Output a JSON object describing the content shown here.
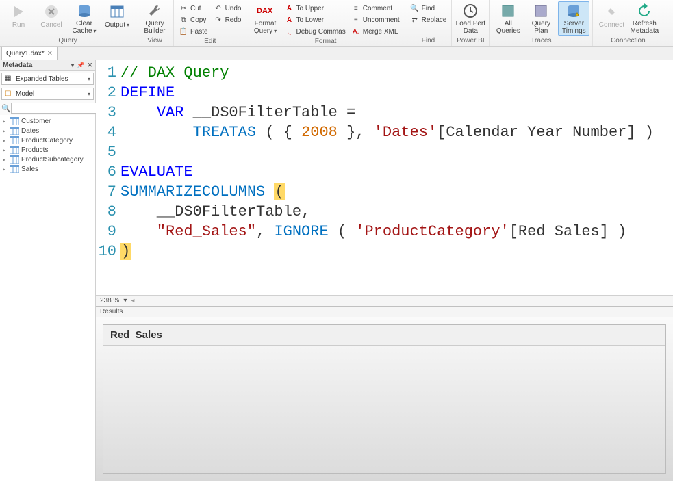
{
  "ribbon": {
    "groups": {
      "query": {
        "label": "Query",
        "run": "Run",
        "cancel": "Cancel",
        "clear_cache": "Clear\nCache",
        "output": "Output"
      },
      "view": {
        "label": "View",
        "query_builder": "Query\nBuilder"
      },
      "edit": {
        "label": "Edit",
        "cut": "Cut",
        "copy": "Copy",
        "paste": "Paste",
        "undo": "Undo",
        "redo": "Redo"
      },
      "format": {
        "label": "Format",
        "dax": "Format\nQuery",
        "to_upper": "To Upper",
        "to_lower": "To Lower",
        "debug_commas": "Debug Commas",
        "comment": "Comment",
        "uncomment": "Uncomment",
        "merge_xml": "Merge XML"
      },
      "find": {
        "label": "Find",
        "find": "Find",
        "replace": "Replace"
      },
      "powerbi": {
        "label": "Power BI",
        "load_perf": "Load Perf\nData"
      },
      "traces": {
        "label": "Traces",
        "all_queries": "All\nQueries",
        "query_plan": "Query\nPlan",
        "server_timings": "Server\nTimings"
      },
      "connection": {
        "label": "Connection",
        "connect": "Connect",
        "refresh": "Refresh\nMetadata"
      }
    }
  },
  "doc_tab": {
    "title": "Query1.dax*"
  },
  "metadata_panel": {
    "title": "Metadata",
    "expanded_tables": "Expanded Tables",
    "model": "Model",
    "search_placeholder": "",
    "tables": [
      "Customer",
      "Dates",
      "ProductCategory",
      "Products",
      "ProductSubcategory",
      "Sales"
    ]
  },
  "code": {
    "lines": [
      {
        "n": 1,
        "tokens": [
          [
            "comment",
            "// DAX Query"
          ]
        ]
      },
      {
        "n": 2,
        "tokens": [
          [
            "keyword",
            "DEFINE"
          ]
        ]
      },
      {
        "n": 3,
        "tokens": [
          [
            "plain",
            "    "
          ],
          [
            "keyword",
            "VAR"
          ],
          [
            "plain",
            " __DS0FilterTable ="
          ]
        ]
      },
      {
        "n": 4,
        "tokens": [
          [
            "plain",
            "        "
          ],
          [
            "func",
            "TREATAS"
          ],
          [
            "plain",
            " ( { "
          ],
          [
            "num",
            "2008"
          ],
          [
            "plain",
            " }, "
          ],
          [
            "str",
            "'Dates'"
          ],
          [
            "plain",
            "[Calendar Year Number] )"
          ]
        ]
      },
      {
        "n": 5,
        "tokens": []
      },
      {
        "n": 6,
        "tokens": [
          [
            "keyword",
            "EVALUATE"
          ]
        ]
      },
      {
        "n": 7,
        "tokens": [
          [
            "func",
            "SUMMARIZECOLUMNS"
          ],
          [
            "plain",
            " "
          ],
          [
            "paren",
            "("
          ]
        ]
      },
      {
        "n": 8,
        "tokens": [
          [
            "plain",
            "    __DS0FilterTable,"
          ]
        ]
      },
      {
        "n": 9,
        "tokens": [
          [
            "plain",
            "    "
          ],
          [
            "str",
            "\"Red_Sales\""
          ],
          [
            "plain",
            ", "
          ],
          [
            "func",
            "IGNORE"
          ],
          [
            "plain",
            " ( "
          ],
          [
            "str",
            "'ProductCategory'"
          ],
          [
            "plain",
            "[Red Sales] )"
          ]
        ]
      },
      {
        "n": 10,
        "tokens": [
          [
            "paren",
            ")"
          ]
        ]
      }
    ],
    "zoom": "238 %"
  },
  "results": {
    "title": "Results",
    "columns": [
      "Red_Sales"
    ]
  }
}
